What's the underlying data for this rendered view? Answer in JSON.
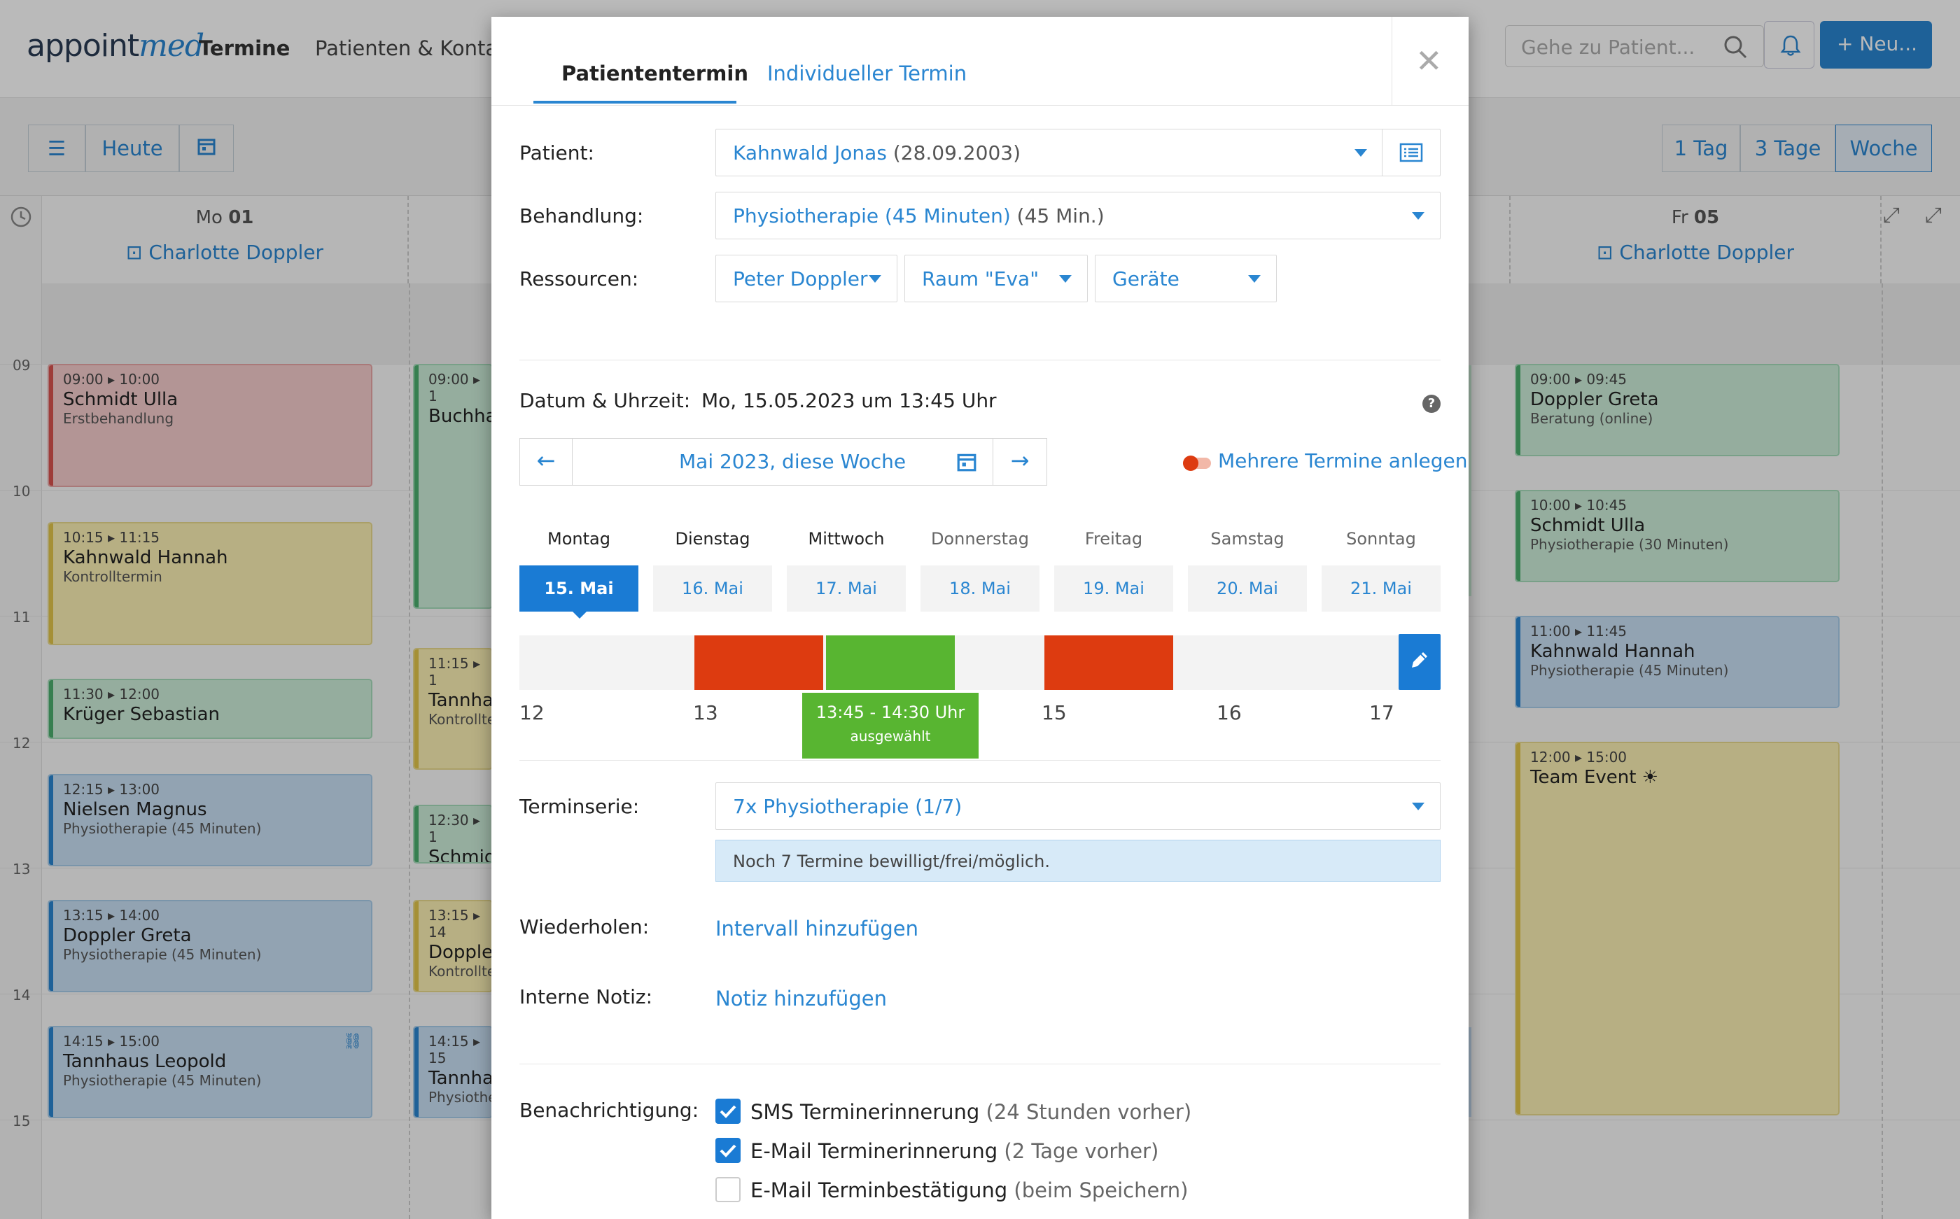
{
  "app": {
    "logo_main": "appoint",
    "logo_accent": "med",
    "nav": [
      "Termine",
      "Patienten & Kontakt"
    ],
    "search_placeholder": "Gehe zu Patient...",
    "new_button": "Neu..."
  },
  "toolbar": {
    "today": "Heute",
    "views": [
      "1 Tag",
      "3 Tage",
      "Woche"
    ],
    "active_view": "Woche"
  },
  "calendar": {
    "columns": [
      {
        "day": "Mo",
        "num": "01",
        "person": "Charlotte Doppler"
      },
      {
        "day": "Fr",
        "num": "05",
        "person": "Charlotte Doppler"
      }
    ],
    "hours": [
      "09",
      "10",
      "11",
      "12",
      "13",
      "14",
      "15"
    ],
    "monday_events": [
      {
        "time": "09:00 ▸ 10:00",
        "name": "Schmidt Ulla",
        "desc": "Erstbehandlung"
      },
      {
        "time": "10:15 ▸ 11:15",
        "name": "Kahnwald Hannah",
        "desc": "Kontrolltermin"
      },
      {
        "time": "11:30 ▸ 12:00",
        "name": "Krüger Sebastian",
        "desc": ""
      },
      {
        "time": "12:15 ▸ 13:00",
        "name": "Nielsen Magnus",
        "desc": "Physiotherapie (45 Minuten)"
      },
      {
        "time": "13:15 ▸ 14:00",
        "name": "Doppler Greta",
        "desc": "Physiotherapie (45 Minuten)"
      },
      {
        "time": "14:15 ▸ 15:00",
        "name": "Tannhaus Leopold",
        "desc": "Physiotherapie (45 Minuten)"
      }
    ],
    "tuesday_events": [
      {
        "time": "09:00 ▸ 1",
        "name": "Buchha",
        "desc": ""
      },
      {
        "time": "11:15 ▸ 1",
        "name": "Tannha",
        "desc": "Kontrollte"
      },
      {
        "time": "12:30 ▸ 1",
        "name": "Schmid",
        "desc": ""
      },
      {
        "time": "13:15 ▸ 14",
        "name": "Doppler",
        "desc": "Kontrollte"
      },
      {
        "time": "14:15 ▸ 15",
        "name": "Tannha",
        "desc": "Physiothe"
      }
    ],
    "friday_events": [
      {
        "time": "09:00 ▸ 09:45",
        "name": "Doppler Greta",
        "desc": "Beratung (online)"
      },
      {
        "time": "10:00 ▸ 10:45",
        "name": "Schmidt Ulla",
        "desc": "Physiotherapie (30 Minuten)"
      },
      {
        "time": "11:00 ▸ 11:45",
        "name": "Kahnwald Hannah",
        "desc": "Physiotherapie (45 Minuten)"
      },
      {
        "time": "12:00 ▸ 15:00",
        "name": "Team Event ☀",
        "desc": ""
      }
    ]
  },
  "modal": {
    "tabs": [
      "Patiententermin",
      "Individueller Termin"
    ],
    "active_tab": "Patiententermin",
    "patient": {
      "label": "Patient:",
      "name": "Kahnwald Jonas",
      "dob": "(28.09.2003)"
    },
    "treatment": {
      "label": "Behandlung:",
      "name": "Physiotherapie (45 Minuten)",
      "duration": "(45 Min.)"
    },
    "resources": {
      "label": "Ressourcen:",
      "items": [
        "Peter Doppler",
        "Raum \"Eva\"",
        "Geräte"
      ]
    },
    "datetime": {
      "label": "Datum & Uhrzeit:",
      "value": "Mo, 15.05.2023 um 13:45 Uhr"
    },
    "week_nav": {
      "label": "Mai 2023, diese Woche"
    },
    "multi_toggle": "Mehrere Termine anlegen",
    "weekdays": [
      "Montag",
      "Dienstag",
      "Mittwoch",
      "Donnerstag",
      "Freitag",
      "Samstag",
      "Sonntag"
    ],
    "dates": [
      "15. Mai",
      "16. Mai",
      "17. Mai",
      "18. Mai",
      "19. Mai",
      "20. Mai",
      "21. Mai"
    ],
    "selected_date": "15. Mai",
    "timeline": {
      "hours": [
        "12",
        "13",
        "15",
        "16",
        "17"
      ],
      "selected_time": "13:45 - 14:30 Uhr",
      "selected_note": "ausgewählt"
    },
    "series": {
      "label": "Terminserie:",
      "value": "7x Physiotherapie (1/7)",
      "info": "Noch 7 Termine bewilligt/frei/möglich."
    },
    "repeat": {
      "label": "Wiederholen:",
      "link": "Intervall hinzufügen"
    },
    "note": {
      "label": "Interne Notiz:",
      "link": "Notiz hinzufügen"
    },
    "notifications": {
      "label": "Benachrichtigung:",
      "items": [
        {
          "text": "SMS Terminerinnerung",
          "detail": "(24 Stunden vorher)",
          "checked": true
        },
        {
          "text": "E-Mail Terminerinnerung",
          "detail": "(2 Tage vorher)",
          "checked": true
        },
        {
          "text": "E-Mail Terminbestätigung",
          "detail": "(beim Speichern)",
          "checked": false
        }
      ]
    }
  },
  "colors": {
    "accent": "#2a86d1",
    "busy": "#dd3b10",
    "free": "#58b531"
  }
}
